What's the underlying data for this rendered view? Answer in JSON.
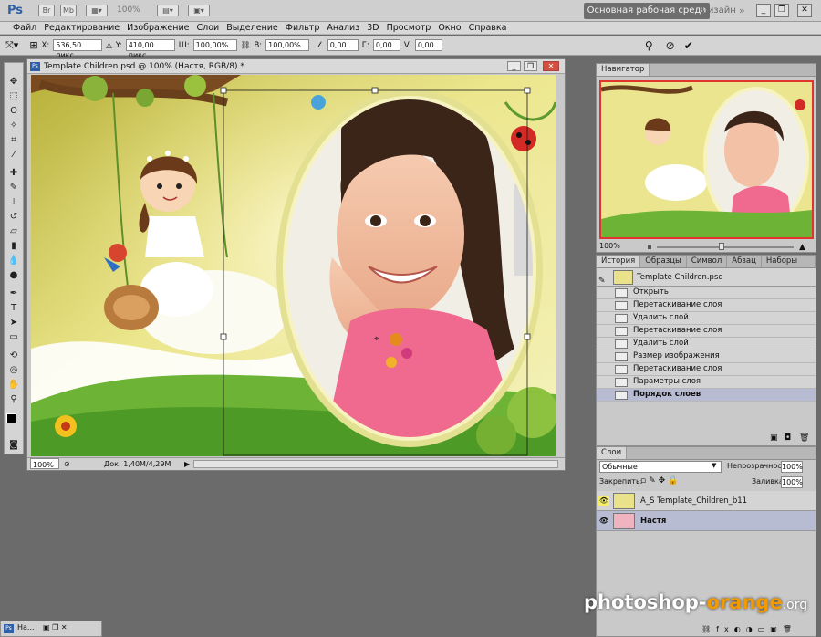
{
  "app": {
    "logo": "Ps",
    "zoom": "100%",
    "workspace_button": "Основная рабочая среда",
    "design_label": "Дизайн",
    "more_label": "»"
  },
  "menu": [
    "Файл",
    "Редактирование",
    "Изображение",
    "Слои",
    "Выделение",
    "Фильтр",
    "Анализ",
    "3D",
    "Просмотр",
    "Окно",
    "Справка"
  ],
  "options": {
    "x_label": "X:",
    "x_value": "536,50 пикс",
    "y_label": "Y:",
    "y_value": "410,00 пикс",
    "w_label": "Ш:",
    "w_value": "100,00%",
    "h_label": "В:",
    "h_value": "100,00%",
    "angle_value": "0,00",
    "g_label": "Г:",
    "g_value": "0,00",
    "v_label": "V:",
    "v_value": "0,00"
  },
  "document": {
    "title": "Template Children.psd @ 100% (Настя, RGB/8) *",
    "status_zoom": "100%",
    "status_doc": "Док: 1,40M/4,29M"
  },
  "navigator": {
    "tab": "Навигатор",
    "zoom": "100%"
  },
  "history": {
    "tabs": [
      "История",
      "Образцы",
      "Символ",
      "Абзац",
      "Наборы кистей"
    ],
    "snapshot": "Template Children.psd",
    "items": [
      "Открыть",
      "Перетаскивание слоя",
      "Удалить слой",
      "Перетаскивание слоя",
      "Удалить слой",
      "Размер изображения",
      "Перетаскивание слоя",
      "Параметры слоя",
      "Порядок слоев"
    ]
  },
  "layers": {
    "tab": "Слои",
    "blend_mode": "Обычные",
    "opacity_label": "Непрозрачность:",
    "opacity_value": "100%",
    "lock_label": "Закрепить:",
    "fill_label": "Заливка:",
    "fill_value": "100%",
    "items": [
      {
        "name": "A_S Template_Children_b11"
      },
      {
        "name": "Настя"
      }
    ]
  },
  "taskbar": {
    "label": "На..."
  },
  "watermark": {
    "part1": "photoshop-",
    "part2": "orange",
    "part3": ".org"
  },
  "colors": {
    "accent_selected": "#b7bcd2",
    "nav_frame": "#e0342c",
    "watermark_orange": "#f39a00"
  }
}
